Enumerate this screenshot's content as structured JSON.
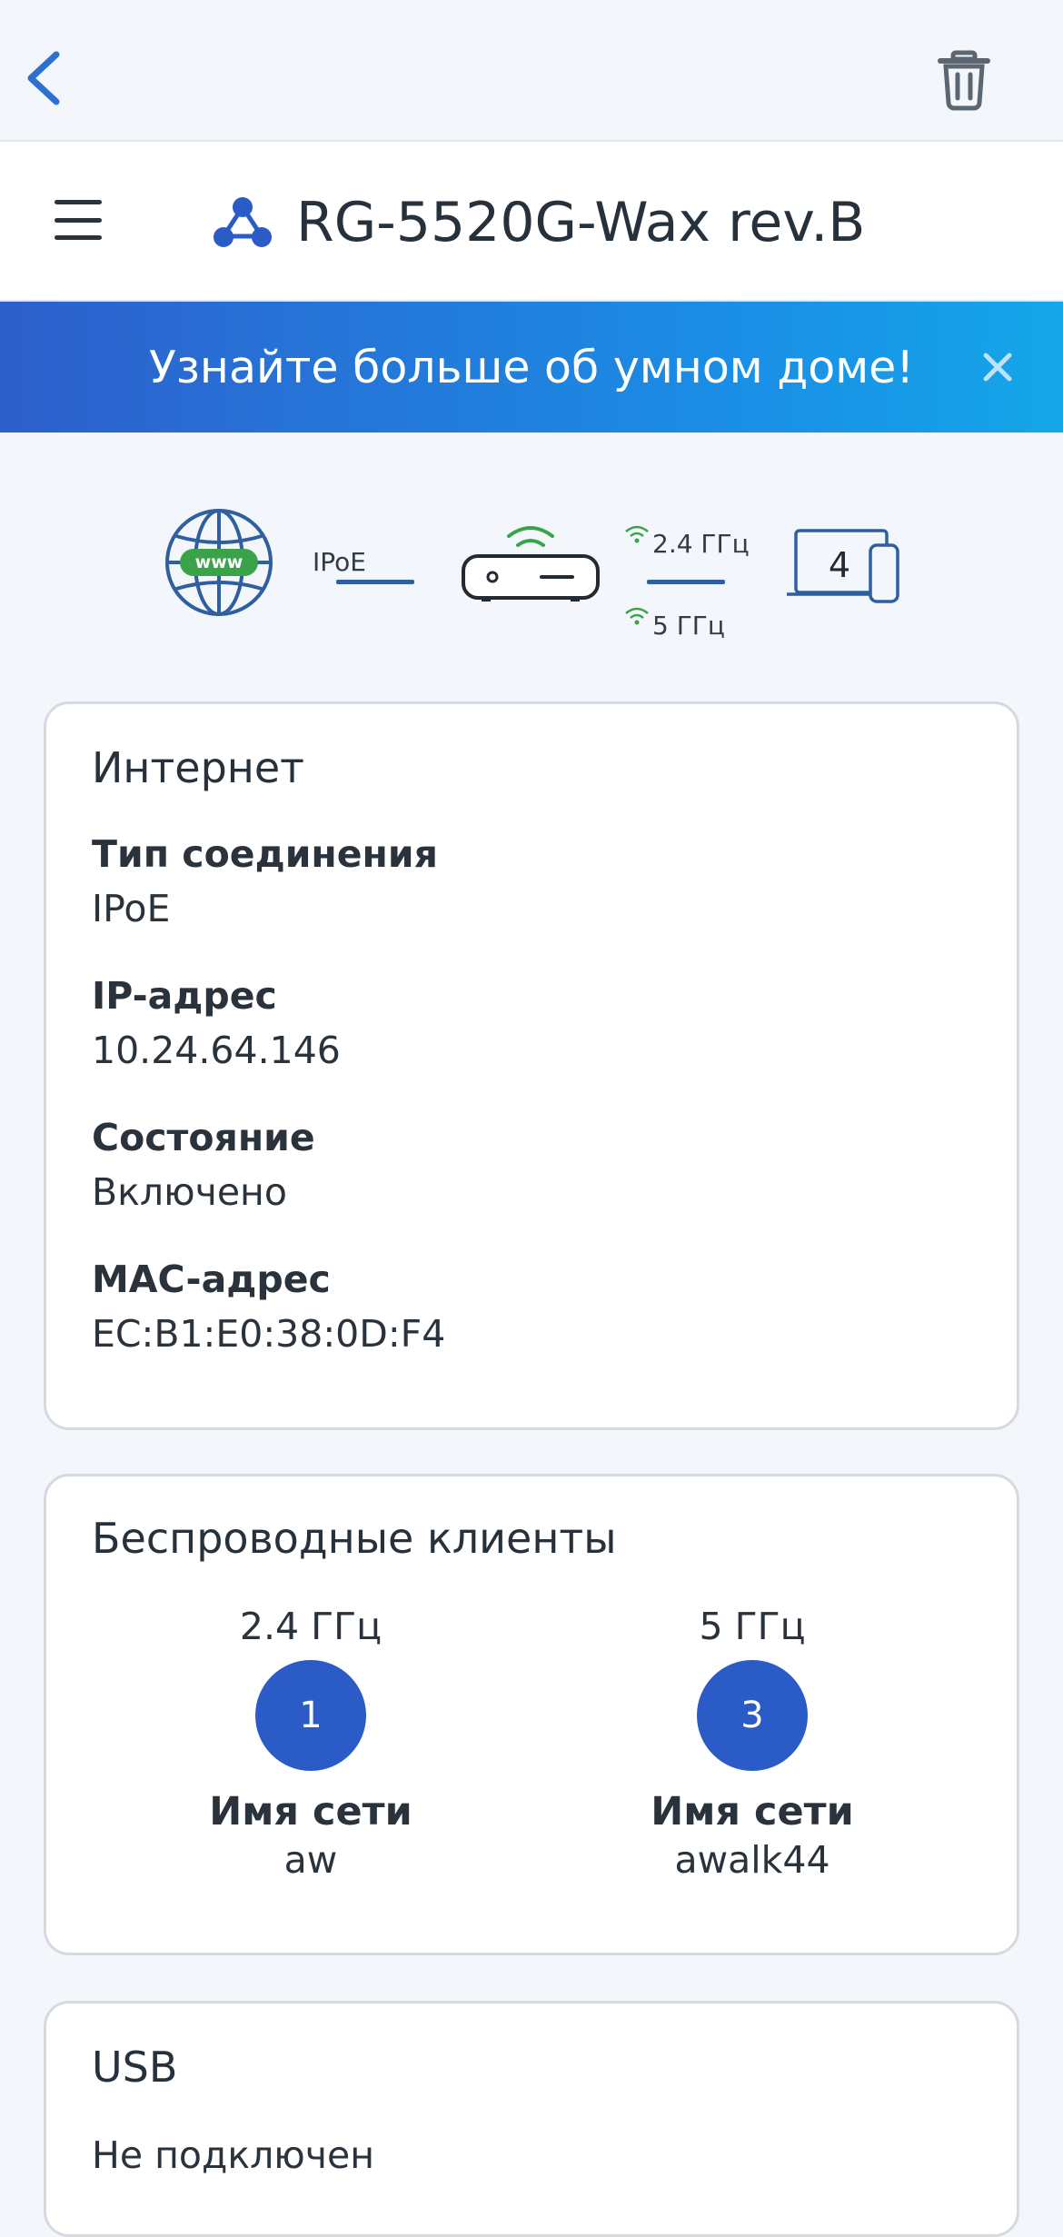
{
  "topbar": {
    "back_icon": "chevron-left-icon",
    "delete_icon": "trash-icon"
  },
  "header": {
    "menu_icon": "hamburger-menu-icon",
    "device_icon": "network-nodes-icon",
    "device_name": "RG-5520G-Wax rev.B"
  },
  "banner": {
    "text": "Узнайте больше об умном доме!",
    "close_icon": "close-icon"
  },
  "topology": {
    "internet_badge": "www",
    "connection_type": "IPoE",
    "band_24": "2.4 ГГц",
    "band_5": "5 ГГц",
    "clients_count": "4",
    "colors": {
      "accent": "#2f5f9e",
      "wifi": "#3aa34a"
    }
  },
  "internet": {
    "title": "Интернет",
    "fields": [
      {
        "label": "Тип соединения",
        "value": "IPoE"
      },
      {
        "label": "IP-адрес",
        "value": "10.24.64.146"
      },
      {
        "label": "Состояние",
        "value": "Включено"
      },
      {
        "label": "MAC-адрес",
        "value": "EC:B1:E0:38:0D:F4"
      }
    ]
  },
  "wireless": {
    "title": "Беспроводные клиенты",
    "bands": [
      {
        "label": "2.4 ГГц",
        "count": "1",
        "network_label": "Имя сети",
        "network_name": "aw"
      },
      {
        "label": "5 ГГц",
        "count": "3",
        "network_label": "Имя сети",
        "network_name": "awalk44"
      }
    ]
  },
  "usb": {
    "title": "USB",
    "status": "Не подключен"
  },
  "colors": {
    "background": "#f3f6fb",
    "primary": "#2a5bc6",
    "banner_start": "#2e5fcc",
    "banner_end": "#14a6e8"
  }
}
